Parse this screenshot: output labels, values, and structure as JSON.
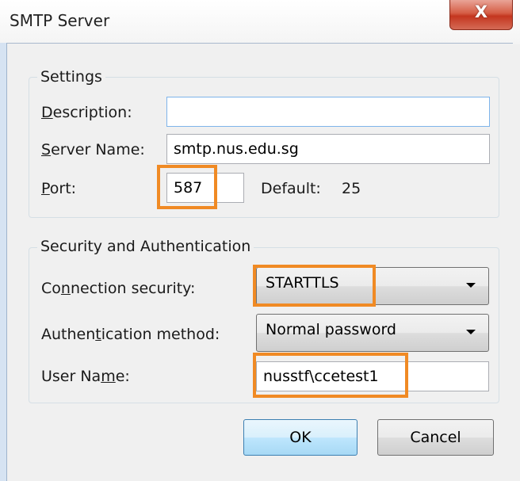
{
  "window": {
    "title": "SMTP Server",
    "close_glyph": "X"
  },
  "settings": {
    "legend": "Settings",
    "description_label": "Description:",
    "description_value": "",
    "server_name_label": "Server Name:",
    "server_name_value": "smtp.nus.edu.sg",
    "port_label": "Port:",
    "port_value": "587",
    "default_label": "Default:",
    "default_value": "25"
  },
  "security": {
    "legend": "Security and Authentication",
    "connection_label": "Connection security:",
    "connection_value": "STARTTLS",
    "auth_label": "Authentication method:",
    "auth_value": "Normal password",
    "username_label": "User Name:",
    "username_value": "nusstf\\ccetest1"
  },
  "buttons": {
    "ok": "OK",
    "cancel": "Cancel"
  },
  "colors": {
    "highlight": "#f08a24",
    "close_button": "#c4361f",
    "focus_border": "#7eb4ea"
  }
}
